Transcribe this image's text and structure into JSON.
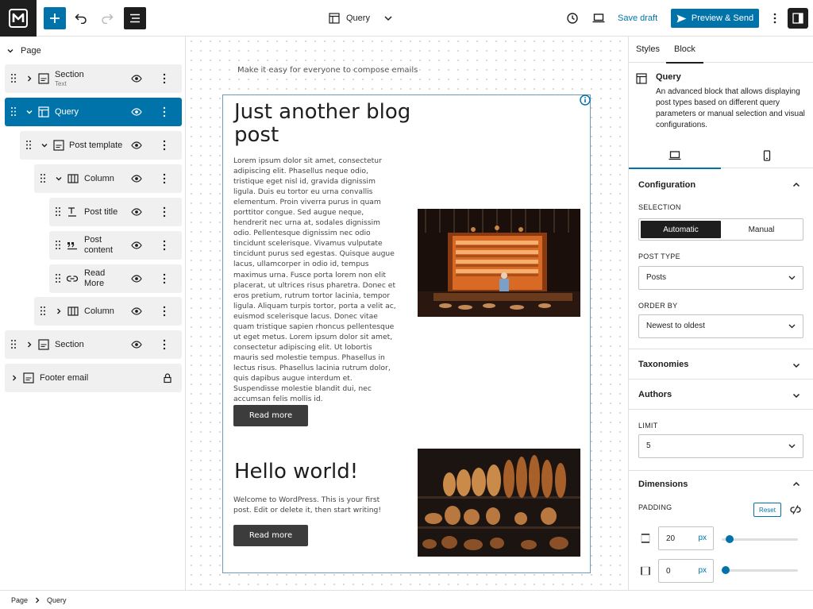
{
  "toolbar": {
    "document_title": "Query",
    "save_draft_label": "Save draft",
    "preview_label": "Preview & Send"
  },
  "layers": {
    "page_label": "Page",
    "items": [
      {
        "label": "Section",
        "sub": "Text"
      },
      {
        "label": "Query"
      },
      {
        "label": "Post template"
      },
      {
        "label": "Column"
      },
      {
        "label": "Post title"
      },
      {
        "label": "Post content"
      },
      {
        "label": "Read More"
      },
      {
        "label": "Column"
      },
      {
        "label": "Section"
      },
      {
        "label": "Footer email"
      }
    ]
  },
  "canvas": {
    "tagline": "Make it easy for everyone to compose emails",
    "posts": [
      {
        "title": "Just another blog post",
        "body": "Lorem ipsum dolor sit amet, consectetur adipiscing elit. Phasellus neque odio, tristique eget nisl id, gravida dignissim ligula. Duis eu tortor eu urna convallis elementum. Proin viverra purus in quam porttitor congue. Sed augue neque, hendrerit nec urna at, sodales dignissim odio. Pellentesque dignissim nec odio tincidunt scelerisque. Vivamus vulputate tincidunt purus sed egestas. Quisque augue lacus, ullamcorper in odio id, tempus maximus urna. Fusce porta lorem non elit placerat, ut ultrices risus pharetra. Donec et eros pretium, rutrum tortor lacinia, tempor ligula. Aliquam turpis tortor, porta a velit ac, euismod scelerisque lacus. Donec vitae quam tristique sapien rhoncus pellentesque ut eget metus. Lorem ipsum dolor sit amet, consectetur adipiscing elit. Ut lobortis mauris sed molestie tempus. Phasellus in lectus risus. Phasellus lacinia rutrum dolor, quis dapibus augue interdum et. Suspendisse molestie blandit dui, nec accumsan felis mollis id.",
        "button": "Read more"
      },
      {
        "title": "Hello world!",
        "body": "Welcome to WordPress. This is your first post. Edit or delete it, then start writing!",
        "button": "Read more"
      }
    ]
  },
  "sidebar": {
    "tabs": [
      "Styles",
      "Block"
    ],
    "block_name": "Query",
    "block_description": "An advanced block that allows displaying post types based on different query parameters or manual selection and visual configurations.",
    "configuration": {
      "title": "Configuration",
      "selection_label": "SELECTION",
      "selection_options": [
        "Automatic",
        "Manual"
      ],
      "post_type_label": "POST TYPE",
      "post_type_value": "Posts",
      "order_by_label": "ORDER BY",
      "order_by_value": "Newest to oldest"
    },
    "taxonomies_label": "Taxonomies",
    "authors_label": "Authors",
    "limit_label": "LIMIT",
    "limit_value": "5",
    "dimensions": {
      "title": "Dimensions",
      "padding_label": "PADDING",
      "reset_label": "Reset",
      "padding_vertical": {
        "value": "20",
        "unit": "px",
        "slider_fraction": 0.06
      },
      "padding_horizontal": {
        "value": "0",
        "unit": "px",
        "slider_fraction": 0.0
      }
    }
  },
  "breadcrumb": [
    "Page",
    "Query"
  ],
  "colors": {
    "accent": "#0073aa",
    "dark": "#1e1e1e"
  }
}
